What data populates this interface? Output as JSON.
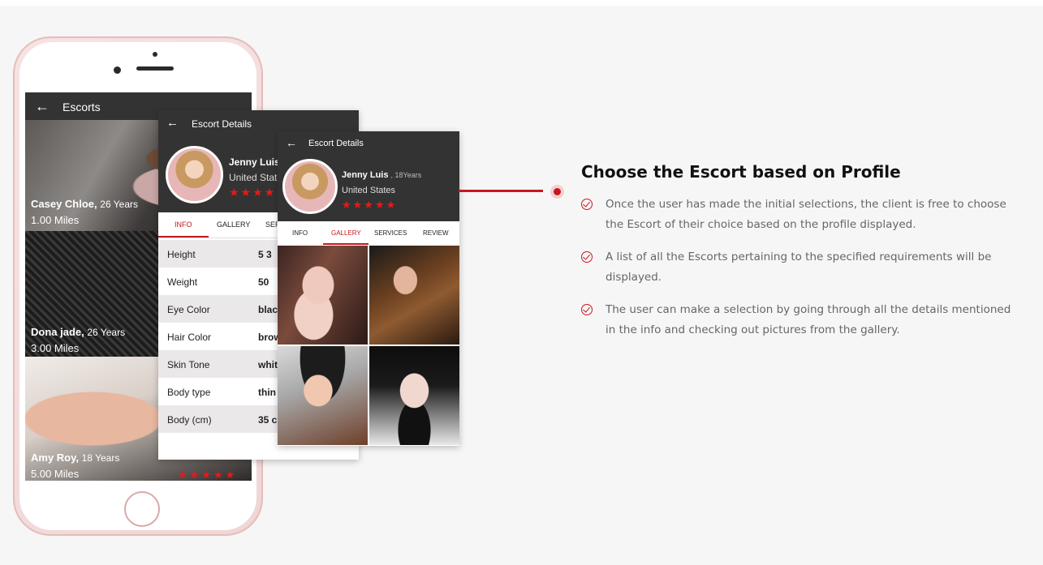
{
  "screen_list": {
    "title": "Escorts",
    "cards": [
      {
        "name": "Casey Chloe,",
        "age": "26 Years",
        "distance": "1.00 Miles"
      },
      {
        "name": "Dona jade,",
        "age": "26 Years",
        "distance": "3.00 Miles"
      },
      {
        "name": "Amy Roy,",
        "age": "18 Years",
        "distance": "5.00 Miles",
        "stars": "★★★★★"
      }
    ]
  },
  "screen_info": {
    "title": "Escort Details",
    "name": "Jenny Luis",
    "country": "United States",
    "stars": "★★★★★",
    "tabs": [
      "INFO",
      "GALLERY",
      "SERVICES"
    ],
    "rows": [
      {
        "label": "Height",
        "value": "5 3"
      },
      {
        "label": "Weight",
        "value": "50"
      },
      {
        "label": "Eye Color",
        "value": "black"
      },
      {
        "label": "Hair Color",
        "value": "brown"
      },
      {
        "label": "Skin Tone",
        "value": "white"
      },
      {
        "label": "Body type",
        "value": "thin"
      },
      {
        "label": "Body (cm)",
        "value": "35 c"
      }
    ]
  },
  "screen_gallery": {
    "title": "Escort Details",
    "name": "Jenny Luis",
    "age": ", 18Years",
    "country": "United States",
    "stars": "★★★★★",
    "tabs": [
      "INFO",
      "GALLERY",
      "SERVICES",
      "REVIEW"
    ]
  },
  "feature": {
    "heading": "Choose the Escort based on Profile",
    "points": [
      "Once the user has made the initial selections, the client is free to choose the Escort of their choice based on the profile displayed.",
      "A list of all the Escorts pertaining to the specified requirements will be displayed.",
      "The user can make a selection by going through all the details mentioned in the info and checking out pictures from the gallery."
    ]
  },
  "colors": {
    "accent": "#c7181f",
    "header": "#333333",
    "star": "#e31b1b"
  }
}
